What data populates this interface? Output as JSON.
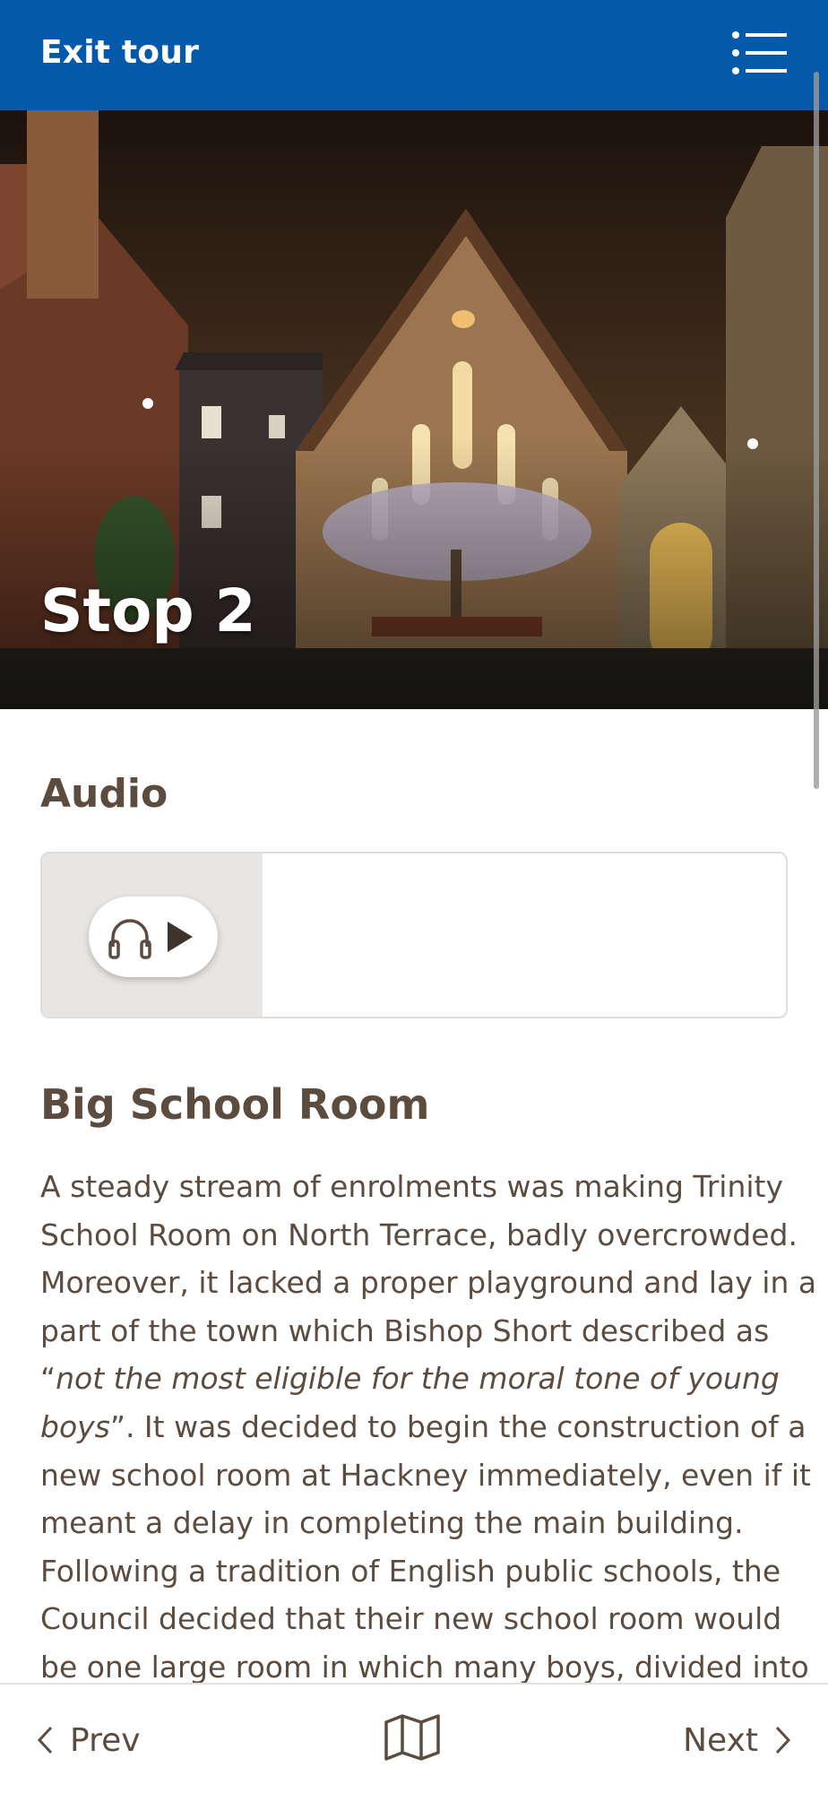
{
  "header": {
    "exit_label": "Exit tour",
    "menu_icon": "list-menu-icon"
  },
  "hero": {
    "stop_title": "Stop 2"
  },
  "audio": {
    "heading": "Audio",
    "player_icons": [
      "headphones-icon",
      "play-icon"
    ]
  },
  "article": {
    "title": "Big School Room",
    "lines": [
      "A steady stream of enrolments was making Trinity",
      "School Room on North Terrace, badly overcrowded.",
      "Moreover, it lacked a proper playground and lay in a",
      "part of the town which Bishop Short described as"
    ],
    "quote_open": "“",
    "quote_italic_1": "not the most eligible for the moral tone of young",
    "quote_italic_2": "boys",
    "quote_close_rest": "”. It was decided to begin the construction of a",
    "lines_after": [
      "new school room at Hackney immediately, even if it",
      "meant a delay in completing the main building.",
      "Following a tradition of English public schools, the",
      "Council decided that their new school room would",
      "be one large room in which many boys, divided into"
    ]
  },
  "footer": {
    "prev_label": "Prev",
    "next_label": "Next",
    "map_icon": "map-icon"
  },
  "colors": {
    "header_bg": "#0559aa",
    "text": "#5b4c3f",
    "audio_panel": "#e9e5e2"
  }
}
